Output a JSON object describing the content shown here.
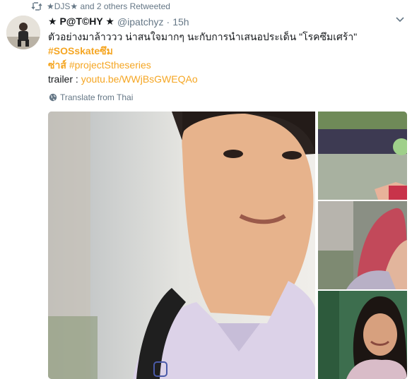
{
  "retweet": {
    "text": "★DJS★ and 2 others Retweeted",
    "icon": "retweet-icon"
  },
  "tweet": {
    "display_name": "★ P@T©HY ★",
    "handle": "@ipatchyz",
    "separator": "·",
    "time": "15h",
    "body_text": "ตัวอย่างมาล้าววว น่าสนใจมากๆ นะกับการนำเสนอประเด็น \"โรคซึมเศร้า\" ",
    "hashtag_1": "#SOSskateซึม",
    "hashtag_1b": "ซ่าส์",
    "hashtag_2": "#projectStheseries",
    "trailer_label": "trailer : ",
    "trailer_link": "youtu.be/WWjBsGWEQAo",
    "translate_label": "Translate from Thai"
  },
  "colors": {
    "accent": "#f5a623",
    "secondary_text": "#657786",
    "primary_text": "#14171a"
  },
  "media": {
    "main": "boy-in-school-uniform-photo",
    "thumbs": [
      "skateboard-street-photo",
      "red-hair-girl-photo",
      "smiling-girl-photo"
    ]
  }
}
